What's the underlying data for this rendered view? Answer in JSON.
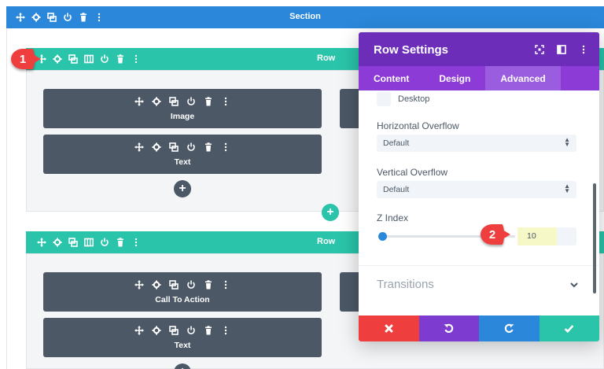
{
  "section": {
    "title": "Section"
  },
  "rows": [
    {
      "title": "Row"
    },
    {
      "title": "Row"
    }
  ],
  "modules": {
    "row1_left": [
      "Image",
      "Text"
    ],
    "row2_left": [
      "Call To Action",
      "Text"
    ]
  },
  "badges": {
    "first": "1",
    "second": "2"
  },
  "panel": {
    "title": "Row Settings",
    "tabs": [
      "Content",
      "Design",
      "Advanced"
    ],
    "active_tab": "Advanced",
    "device_checkbox": "Desktop",
    "horizontal_overflow": {
      "label": "Horizontal Overflow",
      "value": "Default"
    },
    "vertical_overflow": {
      "label": "Vertical Overflow",
      "value": "Default"
    },
    "z_index": {
      "label": "Z Index",
      "value": "10"
    },
    "transitions": "Transitions"
  },
  "colors": {
    "section": "#2b87da",
    "row": "#29c4a9",
    "module": "#4c5866",
    "panel_header": "#6c2eb9",
    "panel_tabs": "#8c3bd6",
    "cancel": "#ef3e3e",
    "undo": "#7e3bd0",
    "redo": "#2b87da",
    "save": "#29c4a9"
  }
}
